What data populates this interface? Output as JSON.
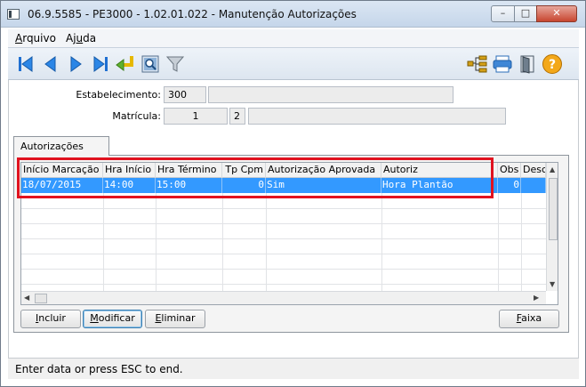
{
  "window": {
    "title": "06.9.5585 - PE3000 - 1.02.01.022 - Manutenção Autorizações",
    "minimize_glyph": "–",
    "maximize_glyph": "□",
    "close_glyph": "✕"
  },
  "menu": {
    "arquivo": "Arquivo",
    "ajuda": "Ajuda"
  },
  "toolbar": {
    "icons": [
      "first-record-icon",
      "previous-record-icon",
      "next-record-icon",
      "last-record-icon",
      "goto-icon",
      "search-icon",
      "filter-icon",
      "hierarchy-icon",
      "print-icon",
      "exit-door-icon",
      "help-icon"
    ],
    "help_glyph": "?"
  },
  "form": {
    "estabelecimento_label": "Estabelecimento:",
    "estabelecimento_value": "300",
    "estabelecimento_desc": "",
    "matricula_label": "Matrícula:",
    "matricula_value": "1",
    "matricula_digit": "2",
    "matricula_desc": ""
  },
  "tab": {
    "label": "Autorizações"
  },
  "grid": {
    "columns": [
      "Início Marcação",
      "Hra Início",
      "Hra Término",
      "Tp Cpm",
      "Autorização Aprovada",
      "Autoriz",
      "Obs",
      "Descr"
    ],
    "rows": [
      {
        "inicio": "18/07/2015",
        "hra_inicio": "14:00",
        "hra_termino": "15:00",
        "tp_cpm": "0",
        "aprovada": "Sim",
        "autoriz": "Hora Plantão",
        "obs": "0",
        "descr": ""
      }
    ]
  },
  "buttons": {
    "incluir_u": "I",
    "incluir_rest": "ncluir",
    "modificar_u": "M",
    "modificar_rest": "odificar",
    "eliminar_u": "E",
    "eliminar_rest": "liminar",
    "faixa_u": "F",
    "faixa_rest": "aixa"
  },
  "status": {
    "text": "Enter data or press ESC to end."
  },
  "colors": {
    "selection": "#3399ff",
    "highlight_box": "#e0121f",
    "nav_blue": "#1f6fd1"
  }
}
